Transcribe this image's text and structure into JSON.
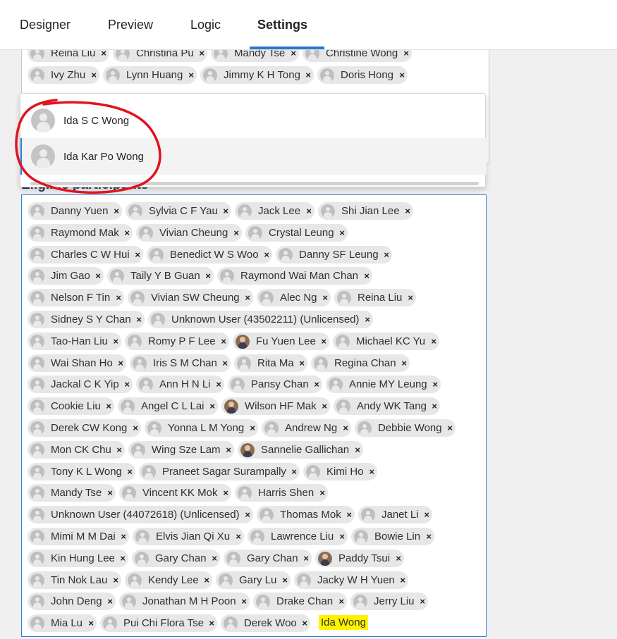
{
  "tabs": [
    {
      "label": "Designer",
      "active": false
    },
    {
      "label": "Preview",
      "active": false
    },
    {
      "label": "Logic",
      "active": false
    },
    {
      "label": "Settings",
      "active": true
    }
  ],
  "upper_chips": [
    [
      "Reina Liu",
      "Christina Pu",
      "Mandy Tse",
      "Christine Wong"
    ],
    [
      "Ivy Zhu",
      "Lynn Huang",
      "Jimmy K H Tong",
      "Doris Hong"
    ]
  ],
  "eligible_label": "Eligible participants",
  "suggestions": [
    "Ida S C Wong",
    "Ida Kar Po Wong"
  ],
  "participants": [
    [
      "Danny Yuen",
      "Sylvia C F Yau",
      "Jack Lee",
      "Shi Jian Lee"
    ],
    [
      "Raymond Mak",
      "Vivian Cheung",
      "Crystal Leung"
    ],
    [
      "Charles C W Hui",
      "Benedict W S Woo",
      "Danny SF Leung"
    ],
    [
      "Jim Gao",
      "Taily Y B Guan",
      "Raymond Wai Man Chan"
    ],
    [
      "Nelson F Tin",
      "Vivian SW Cheung",
      "Alec Ng",
      "Reina Liu"
    ],
    [
      "Sidney S Y Chan",
      "Unknown User (43502211) (Unlicensed)"
    ],
    [
      "Tao-Han Liu",
      "Romy P F Lee",
      "Fu Yuen Lee",
      "Michael KC Yu"
    ],
    [
      "Wai Shan Ho",
      "Iris S M Chan",
      "Rita Ma",
      "Regina Chan"
    ],
    [
      "Jackal C K Yip",
      "Ann H N Li",
      "Pansy Chan",
      "Annie MY Leung"
    ],
    [
      "Cookie Liu",
      "Angel C L Lai",
      "Wilson HF Mak",
      "Andy WK Tang"
    ],
    [
      "Derek CW Kong",
      "Yonna L M Yong",
      "Andrew Ng",
      "Debbie Wong"
    ],
    [
      "Mon CK Chu",
      "Wing Sze Lam",
      "Sannelie Gallichan"
    ],
    [
      "Tony K L Wong",
      "Praneet Sagar Surampally",
      "Kimi Ho"
    ],
    [
      "Mandy Tse",
      "Vincent KK Mok",
      "Harris Shen"
    ],
    [
      "Unknown User (44072618) (Unlicensed)",
      "Thomas Mok",
      "Janet Li"
    ],
    [
      "Mimi M M Dai",
      "Elvis Jian Qi Xu",
      "Lawrence Liu",
      "Bowie Lin"
    ],
    [
      "Kin Hung Lee",
      "Gary Chan",
      "Gary Chan",
      "Paddy Tsui"
    ],
    [
      "Tin Nok Lau",
      "Kendy Lee",
      "Gary Lu",
      "Jacky W H Yuen"
    ],
    [
      "John Deng",
      "Jonathan M H Poon",
      "Drake Chan",
      "Jerry Liu"
    ],
    [
      "Mia Lu",
      "Pui Chi Flora Tse",
      "Derek Woo"
    ]
  ],
  "photo_avatars": [
    "Fu Yuen Lee",
    "Wilson HF Mak",
    "Sannelie Gallichan",
    "Paddy Tsui"
  ],
  "typed_text": "Ida Wong",
  "remove_symbol": "×",
  "colors": {
    "accent": "#2e7fd8",
    "highlight": "#fff200",
    "annotation": "#e0141e"
  }
}
